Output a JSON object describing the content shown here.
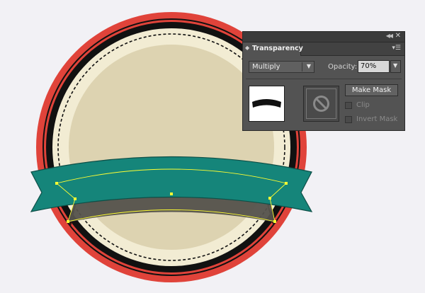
{
  "panel": {
    "title_tab": "Transparency",
    "blend_mode": "Multiply",
    "opacity_label": "Opacity:",
    "opacity_value": "70%",
    "make_mask_label": "Make Mask",
    "clip_label": "Clip",
    "invert_mask_label": "Invert Mask",
    "icons": {
      "collapse": "double-chevron-icon",
      "close": "close-icon",
      "tab": "diamond-icon",
      "menu": "panel-menu-icon",
      "mask": "no-symbol-icon"
    }
  },
  "artwork": {
    "colors": {
      "outer_ring": "#e0433a",
      "black_ring": "#111111",
      "cream_ring": "#f2ecd3",
      "badge_fill": "#ddd3b1",
      "ribbon": "#15857a",
      "ribbon_dark": "#0f5a51",
      "ribbon_shadow": "#54524c",
      "ribbon_back": "#2d1612",
      "selection": "#ffff33",
      "background": "#f2f1f5"
    }
  }
}
